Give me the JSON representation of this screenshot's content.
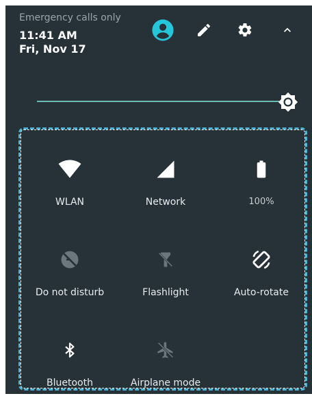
{
  "header": {
    "status_text": "Emergency calls only",
    "time": "11:41 AM",
    "date": "Fri, Nov 17"
  },
  "header_buttons": [
    {
      "name": "account-icon",
      "color": "#26c6da"
    },
    {
      "name": "edit-icon",
      "color": "#ffffff"
    },
    {
      "name": "settings-icon",
      "color": "#ffffff"
    },
    {
      "name": "collapse-icon",
      "color": "#ffffff"
    }
  ],
  "brightness": {
    "icon": "brightness-icon",
    "level": 1.0,
    "track_color": "#6dbcb6"
  },
  "tiles": [
    {
      "label": "WLAN",
      "icon": "wifi-icon",
      "state": "on"
    },
    {
      "label": "Network",
      "icon": "signal-icon",
      "state": "on"
    },
    {
      "label": "100%",
      "icon": "battery-icon",
      "state": "on"
    },
    {
      "label": "Do not disturb",
      "icon": "do-not-disturb-icon",
      "state": "off"
    },
    {
      "label": "Flashlight",
      "icon": "flashlight-icon",
      "state": "off"
    },
    {
      "label": "Auto-rotate",
      "icon": "auto-rotate-icon",
      "state": "on"
    },
    {
      "label": "Bluetooth",
      "icon": "bluetooth-icon",
      "state": "on"
    },
    {
      "label": "Airplane mode",
      "icon": "airplane-icon",
      "state": "off"
    }
  ],
  "colors": {
    "panel_bg": "#263238",
    "accent": "#26c6da",
    "inactive_icon": "#6b777c",
    "highlight_border": "#4fb4d8"
  }
}
